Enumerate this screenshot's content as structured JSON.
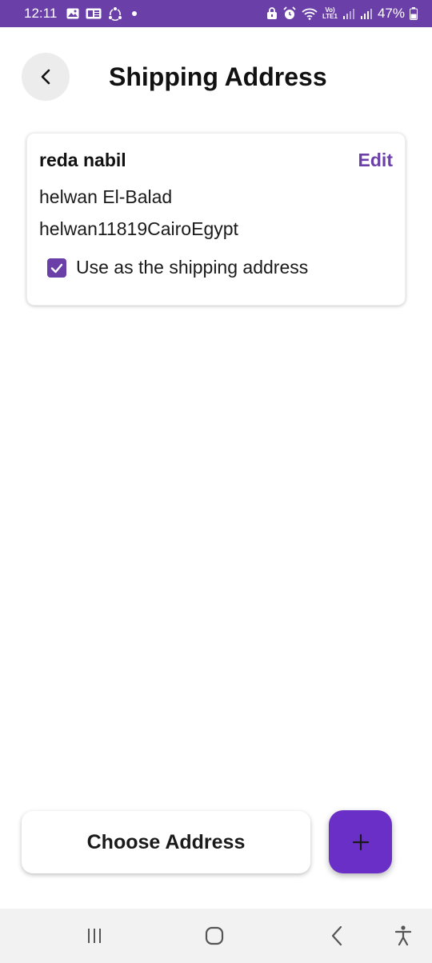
{
  "status_bar": {
    "time": "12:11",
    "battery_percent": "47%",
    "volte_label": "Vo)",
    "lte_label": "LTE1",
    "left_icons": [
      "gallery-icon",
      "news-icon",
      "sync-icon",
      "notification-dot-icon"
    ],
    "right_icons": [
      "lock-icon",
      "alarm-icon",
      "wifi-icon",
      "signal-icon",
      "signal-icon",
      "battery-icon"
    ]
  },
  "header": {
    "title": "Shipping Address",
    "back_icon": "chevron-left-icon"
  },
  "address": {
    "name": "reda nabil",
    "edit_label": "Edit",
    "line1": "helwan El-Balad",
    "line2": "helwan11819CairoEgypt",
    "use_as_shipping_label": "Use as the shipping address",
    "use_as_shipping_checked": true
  },
  "actions": {
    "choose_address_label": "Choose Address",
    "add_icon": "plus-icon"
  },
  "nav_bar": {
    "items": [
      "recent-apps-icon",
      "home-icon",
      "back-icon",
      "accessibility-icon"
    ]
  },
  "colors": {
    "accent": "#6a3fa8",
    "fab": "#6a2fc6",
    "status_bar": "#6a3fa8"
  }
}
